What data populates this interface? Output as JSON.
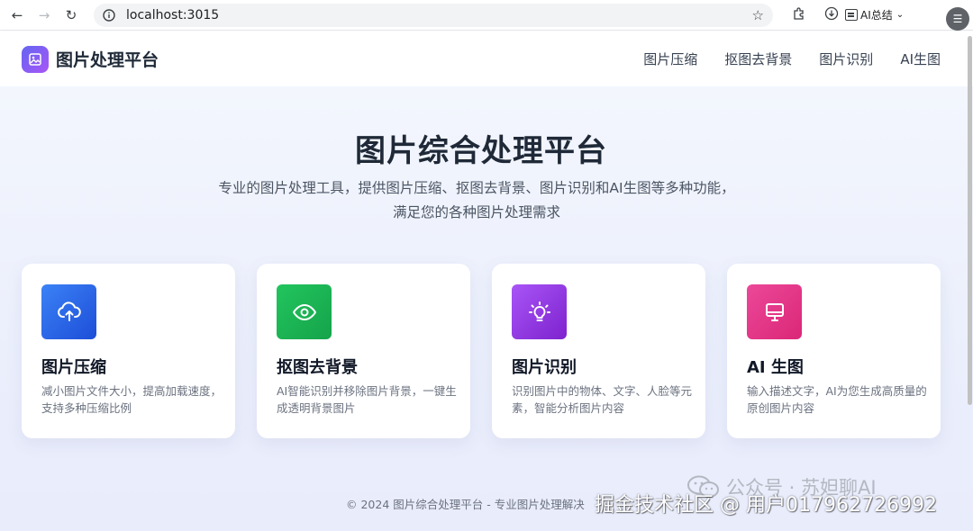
{
  "browser": {
    "url": "localhost:3015",
    "ai_summary_label": "AI总结"
  },
  "header": {
    "brand": "图片处理平台",
    "nav": [
      "图片压缩",
      "抠图去背景",
      "图片识别",
      "AI生图"
    ]
  },
  "hero": {
    "title": "图片综合处理平台",
    "subtitle_line1": "专业的图片处理工具，提供图片压缩、抠图去背景、图片识别和AI生图等多种功能，",
    "subtitle_line2": "满足您的各种图片处理需求"
  },
  "cards": [
    {
      "icon": "cloud-upload-icon",
      "title": "图片压缩",
      "desc": "减小图片文件大小，提高加载速度，支持多种压缩比例",
      "color": "#2563eb"
    },
    {
      "icon": "eye-icon",
      "title": "抠图去背景",
      "desc": "AI智能识别并移除图片背景，一键生成透明背景图片",
      "color": "#16a34a"
    },
    {
      "icon": "lightbulb-icon",
      "title": "图片识别",
      "desc": "识别图片中的物体、文字、人脸等元素，智能分析图片内容",
      "color": "#9333ea"
    },
    {
      "icon": "monitor-icon",
      "title": "AI 生图",
      "desc": "输入描述文字，AI为您生成高质量的原创图片内容",
      "color": "#db2777"
    }
  ],
  "footer": {
    "text": "© 2024 图片综合处理平台 - 专业图片处理解决"
  },
  "watermark": {
    "wechat_text": "公众号 · 苏妲聊AI",
    "community_text": "掘金技术社区 @ 用户01796272699​2"
  }
}
